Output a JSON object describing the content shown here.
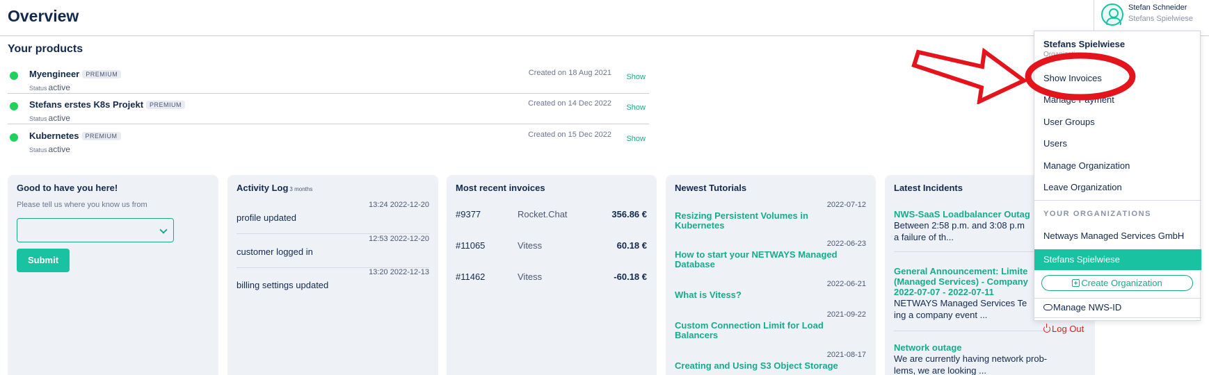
{
  "header": {
    "title": "Overview",
    "user_name": "Stefan Schneider",
    "user_org": "Stefans Spielwiese"
  },
  "products": {
    "title": "Your products",
    "status_label": "Status",
    "show_label": "Show",
    "items": [
      {
        "name": "Myengineer",
        "badge": "PREMIUM",
        "status": "active",
        "created": "Created on 18 Aug 2021"
      },
      {
        "name": "Stefans erstes K8s Projekt",
        "badge": "PREMIUM",
        "status": "active",
        "created": "Created on 14 Dec 2022"
      },
      {
        "name": "Kubernetes",
        "badge": "PREMIUM",
        "status": "active",
        "created": "Created on 15 Dec 2022"
      }
    ]
  },
  "welcome": {
    "title": "Good to have you here!",
    "hint": "Please tell us where you know us from",
    "select_value": "",
    "submit_label": "Submit"
  },
  "activity": {
    "title": "Activity Log",
    "period": "3 months",
    "items": [
      {
        "time": "13:24 2022-12-20",
        "text": "profile updated"
      },
      {
        "time": "12:53 2022-12-20",
        "text": "customer logged in"
      },
      {
        "time": "13:20 2022-12-13",
        "text": "billing settings updated"
      }
    ]
  },
  "invoices": {
    "title": "Most recent invoices",
    "items": [
      {
        "number": "#9377",
        "name": "Rocket.Chat",
        "amount": "356.86 €"
      },
      {
        "number": "#11065",
        "name": "Vitess",
        "amount": "60.18 €"
      },
      {
        "number": "#11462",
        "name": "Vitess",
        "amount": "-60.18 €"
      }
    ]
  },
  "tutorials": {
    "title": "Newest Tutorials",
    "items": [
      {
        "date": "2022-07-12",
        "title": "Resizing Persistent Volumes in Kubernetes"
      },
      {
        "date": "2022-06-23",
        "title": "How to start your NETWAYS Managed Database"
      },
      {
        "date": "2022-06-21",
        "title": "What is Vitess?"
      },
      {
        "date": "2021-09-22",
        "title": "Custom Connection Limit for Load Balancers"
      },
      {
        "date": "2021-08-17",
        "title": "Creating and Using S3 Object Storage"
      }
    ]
  },
  "incidents": {
    "title": "Latest Incidents",
    "items": [
      {
        "title": "NWS-SaaS Loadbalancer Outag",
        "text_1": "Between 2:58 p.m. and 3:08 p.m",
        "text_2": "a failure of th..."
      },
      {
        "title_1": "General Announcement: Limite",
        "title_2": "(Managed Services) - Company",
        "title_3": "2022-07-07 - 2022-07-11",
        "text_1": "NETWAYS Managed Services Te",
        "text_2": "ing a company event ..."
      },
      {
        "title": "Network outage",
        "text_1": "We are currently having network prob-",
        "text_2": "lems, we are looking ..."
      }
    ]
  },
  "dropdown": {
    "org_name": "Stefans Spielwiese",
    "org_label": "Organization",
    "items": [
      "Show Invoices",
      "Manage Payment",
      "User Groups",
      "Users",
      "Manage Organization",
      "Leave Organization"
    ],
    "section_title": "YOUR ORGANIZATIONS",
    "orgs": [
      "Netways Managed Services GmbH",
      "Stefans Spielwiese"
    ],
    "create_label": "Create Organization",
    "manage_id_label": "Manage NWS-ID",
    "logout_label": "Log Out"
  },
  "colors": {
    "accent": "#19c2a1",
    "link": "#19a98c",
    "navy": "#13294b",
    "status_active": "#1fd15a",
    "annotation_red": "#e3141c",
    "logout": "#e01e1e"
  }
}
